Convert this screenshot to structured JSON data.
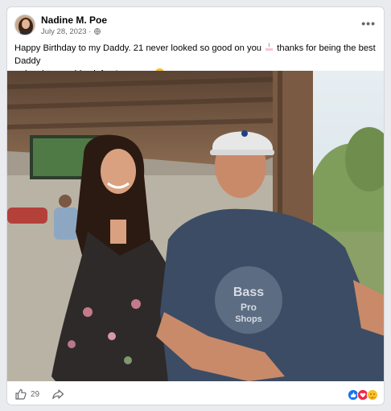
{
  "post": {
    "author": "Nadine M. Poe",
    "date": "July 28, 2023 ·",
    "privacy_icon": "globe-icon",
    "more_label": "•••",
    "text_line1": "Happy Birthday to my Daddy. 21 never looked so good on you",
    "text_line1_tail": "thanks for being the best Daddy",
    "text_line2": "a daughter could ask for. Love you"
  },
  "photo": {
    "hat_logo": "●"
  },
  "footer": {
    "like_count": "29",
    "reaction_icons": [
      "like-reaction-icon",
      "love-reaction-icon",
      "care-reaction-icon"
    ]
  },
  "colors": {
    "accent": "#1877f2",
    "love": "#f02849",
    "meta_gray": "#65676b",
    "card_border": "#d5d7db"
  }
}
